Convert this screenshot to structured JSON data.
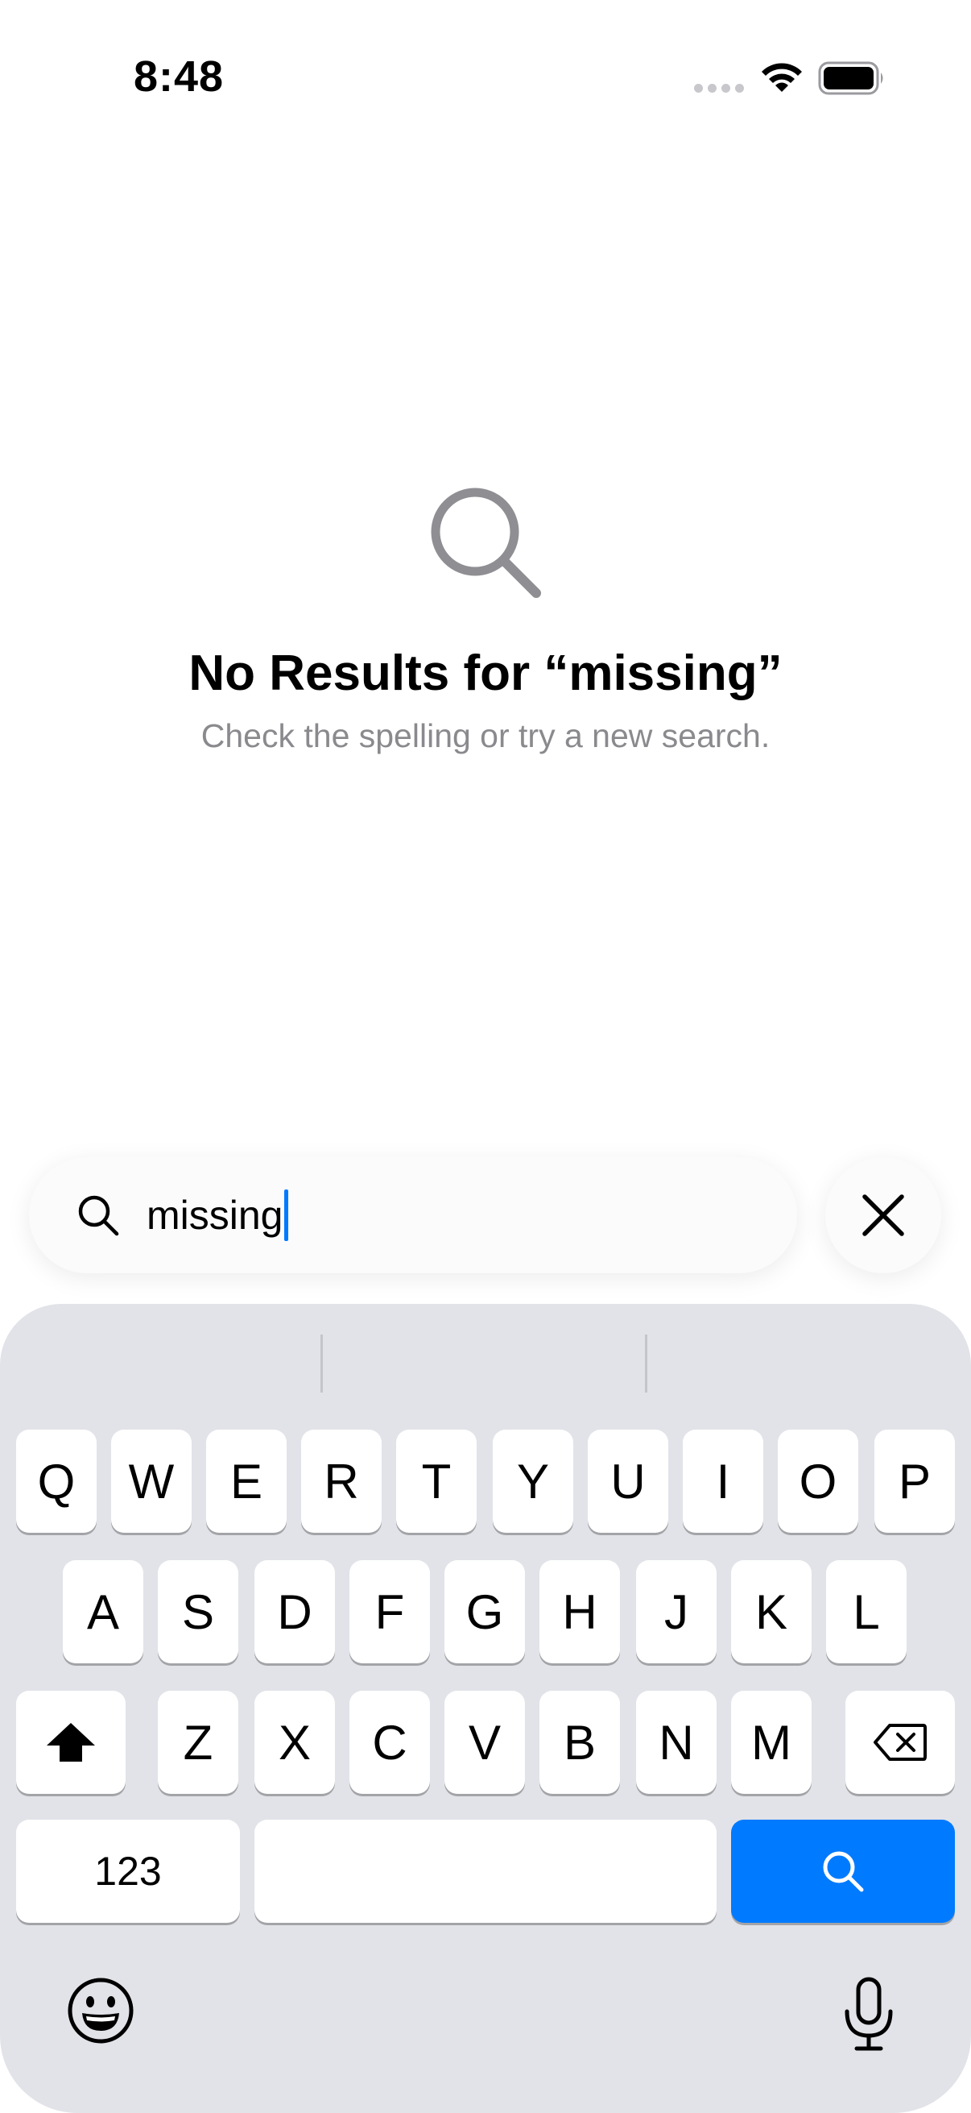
{
  "status_bar": {
    "time": "8:48"
  },
  "empty_state": {
    "title": "No Results for “missing”",
    "subtitle": "Check the spelling or try a new search."
  },
  "search": {
    "value": "missing"
  },
  "keyboard": {
    "row1": [
      "Q",
      "W",
      "E",
      "R",
      "T",
      "Y",
      "U",
      "I",
      "O",
      "P"
    ],
    "row2": [
      "A",
      "S",
      "D",
      "F",
      "G",
      "H",
      "J",
      "K",
      "L"
    ],
    "row3": [
      "Z",
      "X",
      "C",
      "V",
      "B",
      "N",
      "M"
    ],
    "numbers_label": "123"
  },
  "colors": {
    "accent": "#007aff",
    "keyboard_bg": "#e2e3e8",
    "secondary_text": "#8a8a8e"
  },
  "icons": [
    "wifi-icon",
    "battery-icon",
    "search-icon",
    "close-icon",
    "shift-icon",
    "delete-icon",
    "emoji-icon",
    "microphone-icon"
  ]
}
